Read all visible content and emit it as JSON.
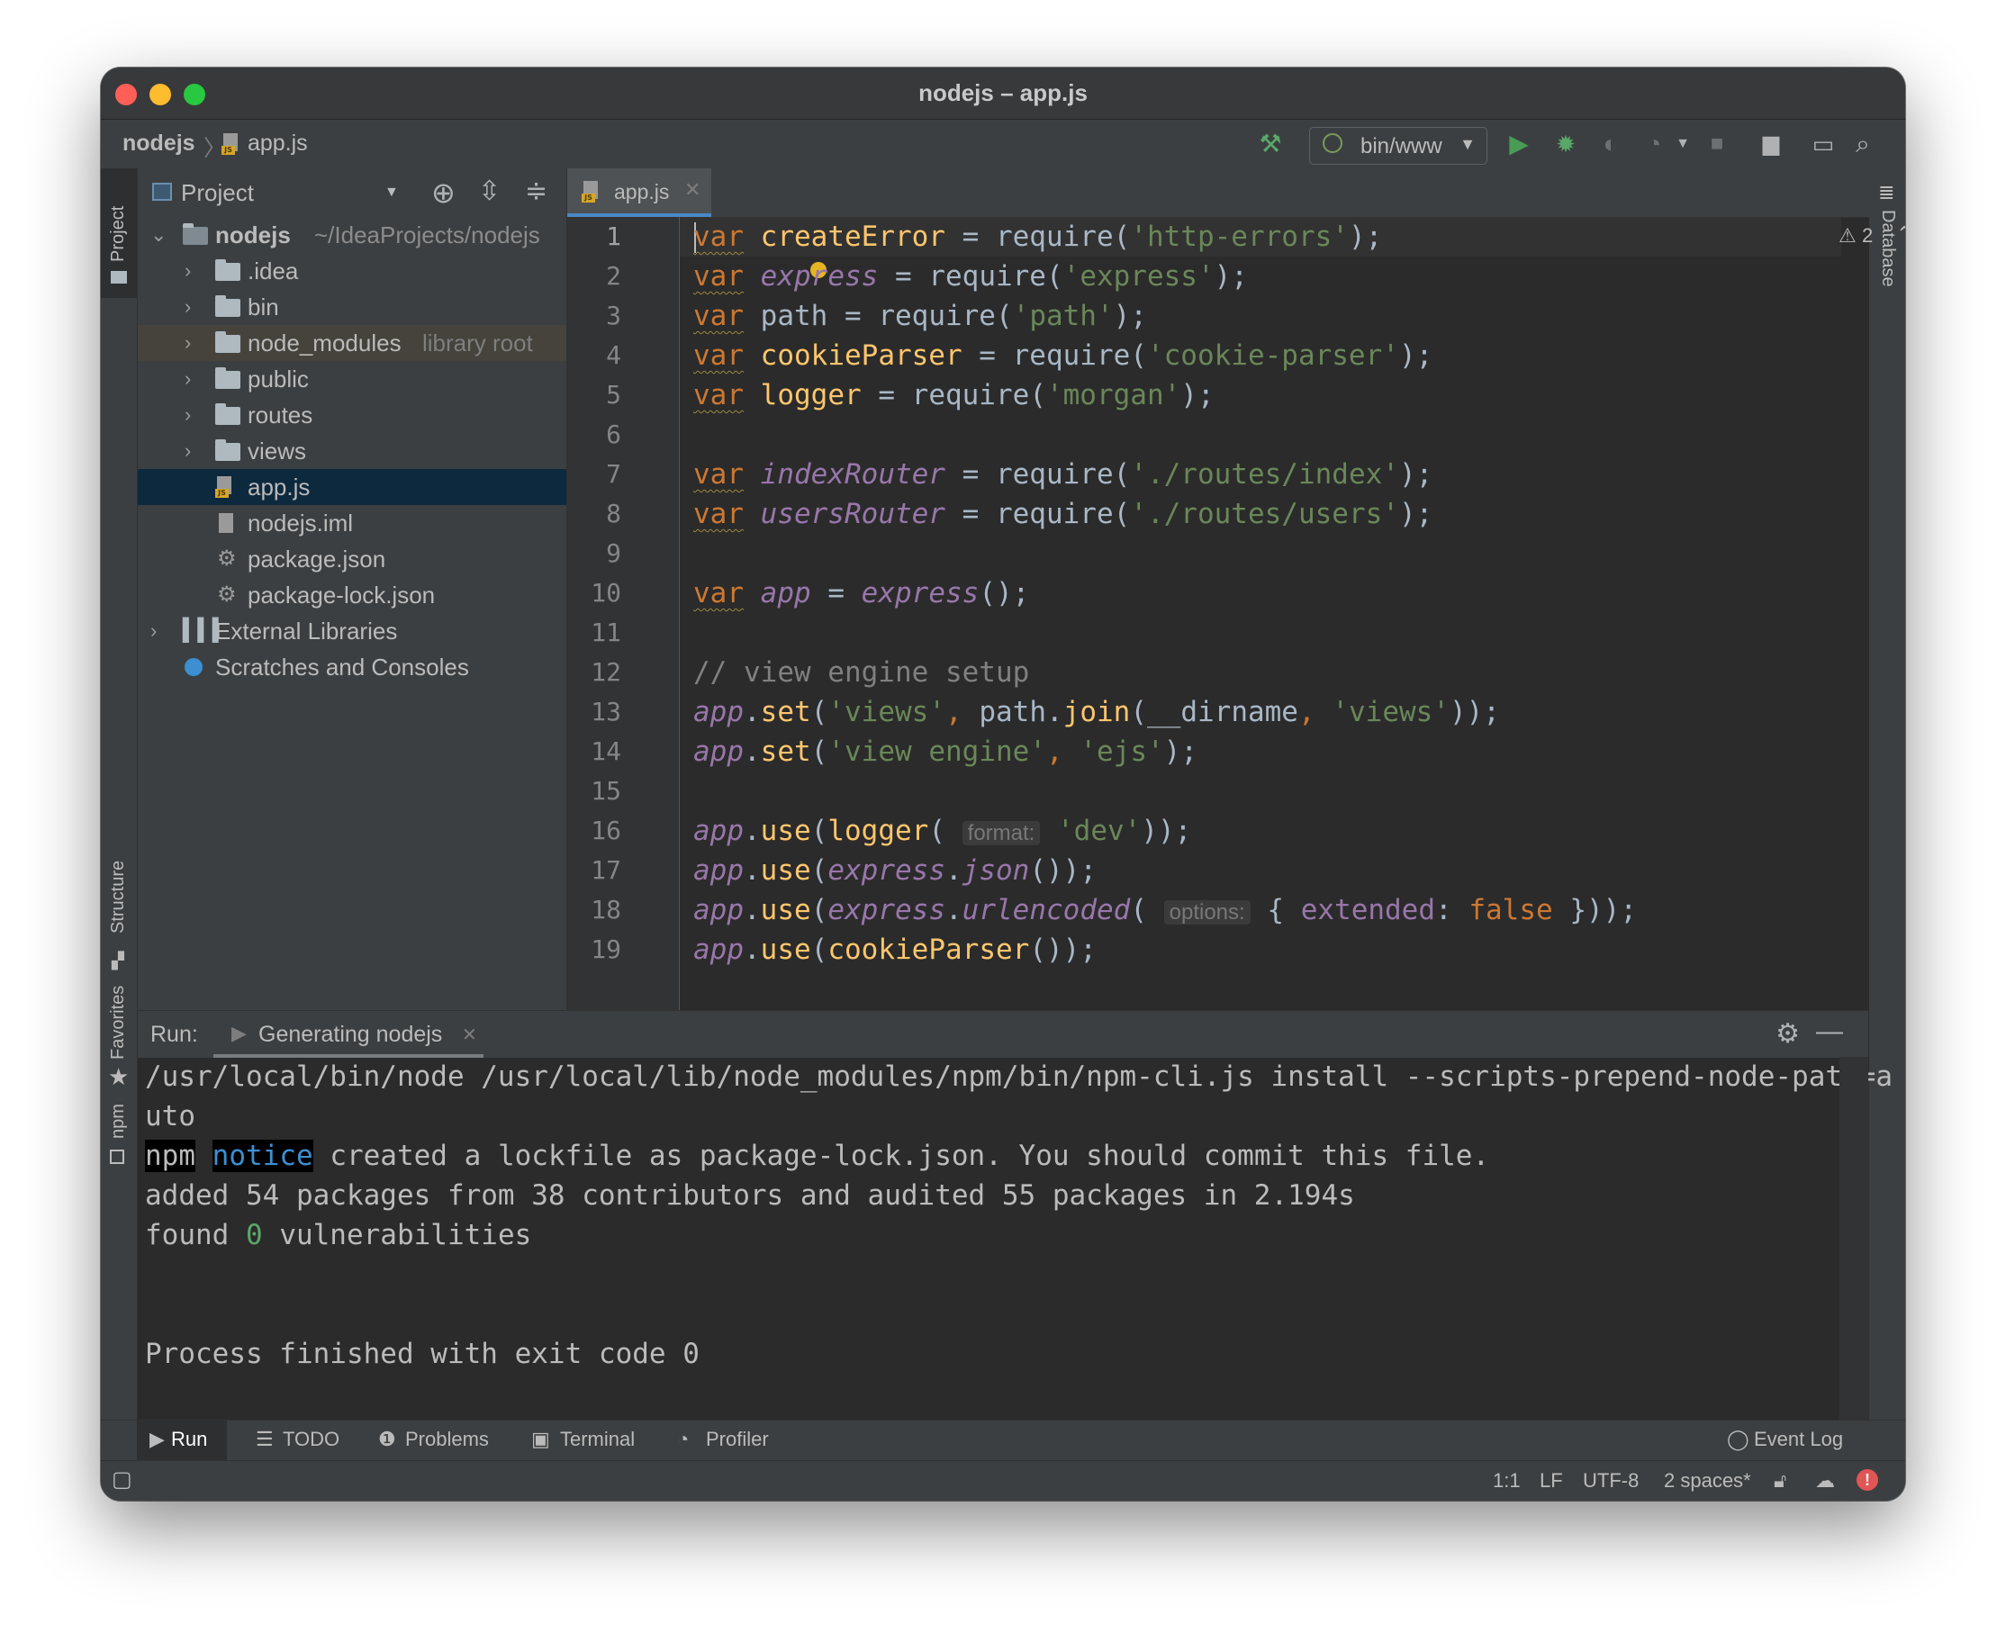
{
  "window": {
    "title": "nodejs – app.js"
  },
  "breadcrumb": {
    "project": "nodejs",
    "file": "app.js"
  },
  "toolbar": {
    "run_config": "bin/www"
  },
  "side_tabs": {
    "project": "Project",
    "structure": "Structure",
    "favorites": "Favorites",
    "npm": "npm",
    "database": "Database"
  },
  "project_panel": {
    "title": "Project",
    "root": {
      "name": "nodejs",
      "path": "~/IdeaProjects/nodejs"
    },
    "items": [
      {
        "name": ".idea",
        "type": "folder"
      },
      {
        "name": "bin",
        "type": "folder"
      },
      {
        "name": "node_modules",
        "type": "folder",
        "note": "library root"
      },
      {
        "name": "public",
        "type": "folder"
      },
      {
        "name": "routes",
        "type": "folder"
      },
      {
        "name": "views",
        "type": "folder"
      },
      {
        "name": "app.js",
        "type": "js"
      },
      {
        "name": "nodejs.iml",
        "type": "iml"
      },
      {
        "name": "package.json",
        "type": "json"
      },
      {
        "name": "package-lock.json",
        "type": "json"
      }
    ],
    "external": "External Libraries",
    "scratches": "Scratches and Consoles"
  },
  "editor": {
    "tab": "app.js",
    "warning_count": "2",
    "line_numbers": [
      "1",
      "2",
      "3",
      "4",
      "5",
      "6",
      "7",
      "8",
      "9",
      "10",
      "11",
      "12",
      "13",
      "14",
      "15",
      "16",
      "17",
      "18",
      "19"
    ],
    "code": {
      "l1": {
        "kw": "var",
        "name": "createError",
        "op": " = ",
        "req": "require",
        "s": "'http-errors'",
        "end": ");"
      },
      "l2": {
        "kw": "var",
        "name": "express",
        "op": " = ",
        "req": "require",
        "s": "'express'",
        "end": ");"
      },
      "l3": {
        "kw": "var",
        "name": "path",
        "op": " = ",
        "req": "require",
        "s": "'path'",
        "end": ");"
      },
      "l4": {
        "kw": "var",
        "name": "cookieParser",
        "op": " = ",
        "req": "require",
        "s": "'cookie-parser'",
        "end": ");"
      },
      "l5": {
        "kw": "var",
        "name": "logger",
        "op": " = ",
        "req": "require",
        "s": "'morgan'",
        "end": ");"
      },
      "l7": {
        "kw": "var",
        "name": "indexRouter",
        "op": " = ",
        "req": "require",
        "s": "'./routes/index'",
        "end": ");"
      },
      "l8": {
        "kw": "var",
        "name": "usersRouter",
        "op": " = ",
        "req": "require",
        "s": "'./routes/users'",
        "end": ");"
      },
      "l10": {
        "kw": "var",
        "name": "app",
        "op": " = ",
        "call": "express",
        "end": "();"
      },
      "l12": {
        "comment": "// view engine setup"
      },
      "l13": {
        "obj": "app",
        "m": "set",
        "s1": "'views'",
        "p": "path",
        "m2": "join",
        "arg": "__dirname",
        "s2": "'views'",
        "end": "));"
      },
      "l14": {
        "obj": "app",
        "m": "set",
        "s1": "'view engine'",
        "s2": "'ejs'",
        "end": ");"
      },
      "l16": {
        "obj": "app",
        "m": "use",
        "f": "logger",
        "hint": "format:",
        "s": "'dev'",
        "end": "));"
      },
      "l17": {
        "obj": "app",
        "m": "use",
        "o2": "express",
        "m2": "json",
        "end": "());"
      },
      "l18": {
        "obj": "app",
        "m": "use",
        "o2": "express",
        "m2": "urlencoded",
        "hint": "options:",
        "prop": "extended",
        "val": "false",
        "end": " }));"
      },
      "l19": {
        "obj": "app",
        "m": "use",
        "f": "cookieParser",
        "end": "());"
      }
    }
  },
  "run": {
    "label": "Run:",
    "tab": "Generating nodejs",
    "output": {
      "line1": "/usr/local/bin/node /usr/local/lib/node_modules/npm/bin/npm-cli.js install --scripts-prepend-node-path=a",
      "line2": "uto",
      "line3_npm": "npm",
      "line3_notice": "notice",
      "line3_rest": " created a lockfile as package-lock.json. You should commit this file.",
      "line4": "added 54 packages from 38 contributors and audited 55 packages in 2.194s",
      "line5_a": "found ",
      "line5_n": "0",
      "line5_b": " vulnerabilities",
      "line6": "Process finished with exit code 0"
    }
  },
  "tool_windows": {
    "run": "Run",
    "todo": "TODO",
    "problems": "Problems",
    "terminal": "Terminal",
    "profiler": "Profiler",
    "event_log": "Event Log"
  },
  "status_bar": {
    "position": "1:1",
    "line_sep": "LF",
    "encoding": "UTF-8",
    "indent": "2 spaces*"
  },
  "colors": {
    "accent": "#4a88c7",
    "selection": "#0d293e",
    "run_green": "#499c54",
    "debug_green": "#59a869",
    "error": "#e05555"
  }
}
